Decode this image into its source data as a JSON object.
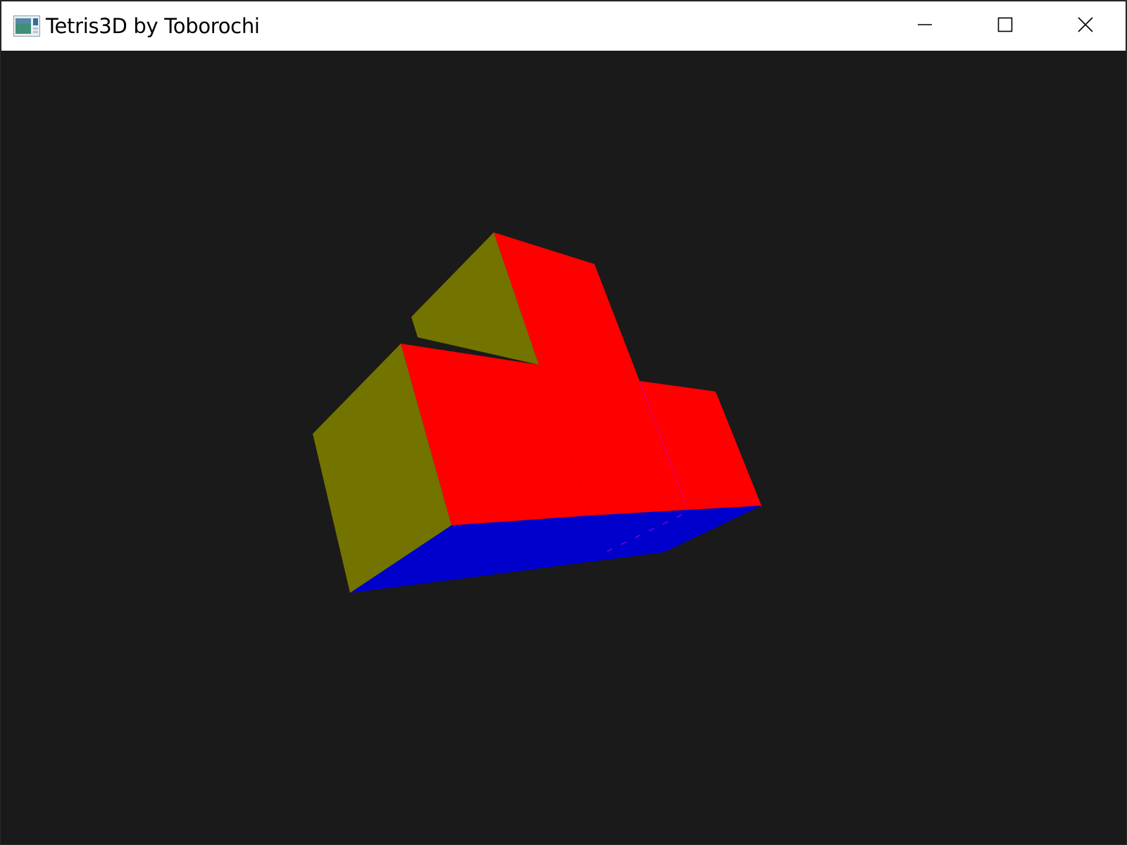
{
  "window": {
    "title": "Tetris3D by Toborochi",
    "controls": [
      "minimize",
      "maximize",
      "close"
    ]
  },
  "icons": {
    "app": "app-window-icon",
    "minimize": "minimize-icon",
    "maximize": "maximize-icon",
    "close": "close-icon"
  },
  "colors": {
    "background": "#1a1a1a",
    "titlebar": "#ffffff",
    "face_front": "#ff0000",
    "face_side": "#737300",
    "face_bottom": "#0000cc",
    "edge_accent": "#cc00cc"
  },
  "scene": {
    "piece": "tetromino",
    "faces": [
      "side-face",
      "front-face",
      "bottom-face"
    ]
  }
}
